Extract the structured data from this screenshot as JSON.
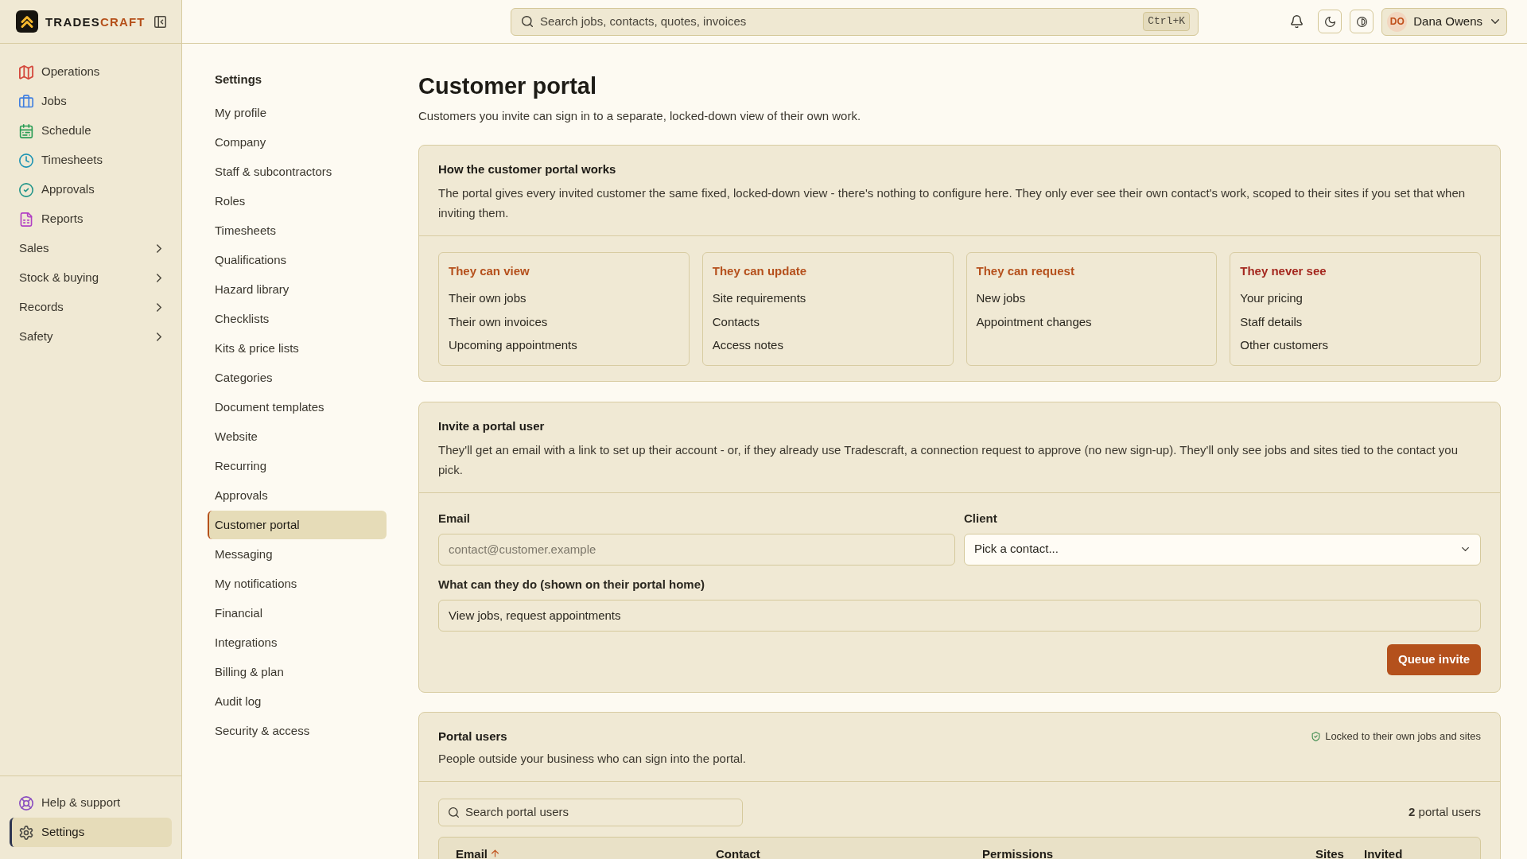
{
  "brand": {
    "name": "TRADES",
    "accent": "CRAFT"
  },
  "sidebar": {
    "items": [
      {
        "label": "Operations",
        "kind": "link",
        "selected": false
      },
      {
        "label": "Jobs",
        "kind": "link",
        "selected": false
      },
      {
        "label": "Schedule",
        "kind": "link",
        "selected": false
      },
      {
        "label": "Timesheets",
        "kind": "link",
        "selected": false
      },
      {
        "label": "Approvals",
        "kind": "link",
        "selected": false
      },
      {
        "label": "Reports",
        "kind": "link",
        "selected": false
      },
      {
        "label": "Sales",
        "kind": "group",
        "selected": false
      },
      {
        "label": "Stock & buying",
        "kind": "group",
        "selected": false
      },
      {
        "label": "Records",
        "kind": "group",
        "selected": false
      },
      {
        "label": "Safety",
        "kind": "group",
        "selected": false
      }
    ],
    "footer": [
      {
        "label": "Help & support",
        "selected": false
      },
      {
        "label": "Settings",
        "selected": true
      }
    ]
  },
  "top_bar": {
    "search": {
      "placeholder": "Search jobs, contacts, quotes, invoices",
      "shortcut": "Ctrl+K"
    },
    "user": {
      "initials": "DO",
      "name": "Dana Owens"
    }
  },
  "settings_nav": {
    "title": "Settings",
    "items": [
      {
        "label": "My profile",
        "selected": false
      },
      {
        "label": "Company",
        "selected": false
      },
      {
        "label": "Staff & subcontractors",
        "selected": false
      },
      {
        "label": "Roles",
        "selected": false
      },
      {
        "label": "Timesheets",
        "selected": false
      },
      {
        "label": "Qualifications",
        "selected": false
      },
      {
        "label": "Hazard library",
        "selected": false
      },
      {
        "label": "Checklists",
        "selected": false
      },
      {
        "label": "Kits & price lists",
        "selected": false
      },
      {
        "label": "Categories",
        "selected": false
      },
      {
        "label": "Document templates",
        "selected": false
      },
      {
        "label": "Website",
        "selected": false
      },
      {
        "label": "Recurring",
        "selected": false
      },
      {
        "label": "Approvals",
        "selected": false
      },
      {
        "label": "Customer portal",
        "selected": true
      },
      {
        "label": "Messaging",
        "selected": false
      },
      {
        "label": "My notifications",
        "selected": false
      },
      {
        "label": "Financial",
        "selected": false
      },
      {
        "label": "Integrations",
        "selected": false
      },
      {
        "label": "Billing & plan",
        "selected": false
      },
      {
        "label": "Audit log",
        "selected": false
      },
      {
        "label": "Security & access",
        "selected": false
      }
    ]
  },
  "page": {
    "title": "Customer portal",
    "subtitle": "Customers you invite can sign in to a separate, locked-down view of their own work."
  },
  "how_it_works": {
    "title": "How the customer portal works",
    "description": "The portal gives every invited customer the same fixed, locked-down view - there's nothing to configure here. They only ever see their own contact's work, scoped to their sites if you set that when inviting them.",
    "columns": [
      {
        "title": "They can view",
        "color": "#b5501c",
        "items": [
          "Their own jobs",
          "Their own invoices",
          "Upcoming appointments"
        ]
      },
      {
        "title": "They can update",
        "color": "#b5501c",
        "items": [
          "Site requirements",
          "Contacts",
          "Access notes"
        ]
      },
      {
        "title": "They can request",
        "color": "#b5501c",
        "items": [
          "New jobs",
          "Appointment changes"
        ]
      },
      {
        "title": "They never see",
        "color": "#a4281f",
        "items": [
          "Your pricing",
          "Staff details",
          "Other customers"
        ]
      }
    ]
  },
  "invite": {
    "title": "Invite a portal user",
    "description": "They'll get an email with a link to set up their account - or, if they already use Tradescraft, a connection request to approve (no new sign-up). They'll only see jobs and sites tied to the contact you pick.",
    "fields": [
      {
        "kind": "text",
        "label": "Email",
        "placeholder": "contact@customer.example"
      },
      {
        "kind": "select",
        "label": "Client",
        "value": "Pick a contact..."
      },
      {
        "kind": "text",
        "label": "What can they do (shown on their portal home)",
        "value": "View jobs, request appointments"
      }
    ],
    "submit": "Queue invite"
  },
  "portal_users": {
    "title": "Portal users",
    "description": "People outside your business who can sign into the portal.",
    "note": "Locked to their own jobs and sites",
    "search": {
      "placeholder": "Search portal users"
    },
    "count": "**2** portal users",
    "table": {
      "columns": [
        {
          "label": "Email",
          "sorted": true
        },
        {
          "label": "Contact",
          "sorted": false
        },
        {
          "label": "Permissions",
          "sorted": false
        },
        {
          "label": "Sites",
          "sorted": false
        },
        {
          "label": "Invited",
          "sorted": false
        }
      ]
    }
  }
}
